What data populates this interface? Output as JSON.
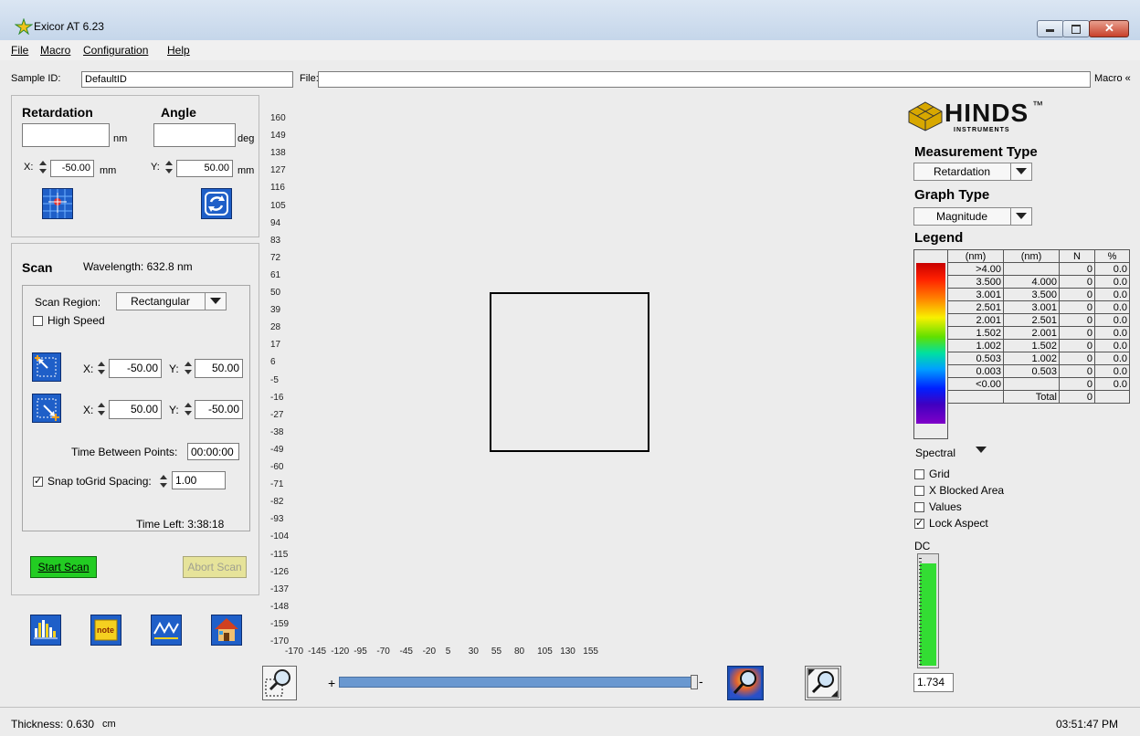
{
  "window": {
    "title": "Exicor AT 6.23"
  },
  "menu": [
    "File",
    "Macro",
    "Configuration",
    "Help"
  ],
  "topbar": {
    "sample_id_label": "Sample ID:",
    "sample_id_value": "DefaultID",
    "file_label": "File:",
    "file_value": "",
    "macro_label": "Macro «"
  },
  "measure": {
    "retardation_label": "Retardation",
    "angle_label": "Angle",
    "retardation_value": "",
    "retardation_unit": "nm",
    "angle_value": "",
    "angle_unit": "deg",
    "x_label": "X:",
    "x_value": "-50.00",
    "x_unit": "mm",
    "y_label": "Y:",
    "y_value": "50.00",
    "y_unit": "mm"
  },
  "scan": {
    "title": "Scan",
    "wavelength": "Wavelength: 632.8 nm",
    "region_label": "Scan Region:",
    "region_value": "Rectangular",
    "high_speed_label": "High Speed",
    "p1_x_label": "X:",
    "p1_x": "-50.00",
    "p1_y_label": "Y:",
    "p1_y": "50.00",
    "p2_x_label": "X:",
    "p2_x": "50.00",
    "p2_y_label": "Y:",
    "p2_y": "-50.00",
    "time_between_label": "Time Between Points:",
    "time_between_value": "00:00:00",
    "snap_label": "Snap to",
    "grid_spacing_label": "Grid Spacing:",
    "grid_spacing_value": "1.00",
    "time_left": "Time Left:  3:38:18",
    "start_label": "Start Scan",
    "abort_label": "Abort Scan"
  },
  "graph": {
    "y_ticks": [
      "160",
      "149",
      "138",
      "127",
      "116",
      "105",
      "94",
      "83",
      "72",
      "61",
      "50",
      "39",
      "28",
      "17",
      "6",
      "-5",
      "-16",
      "-27",
      "-38",
      "-49",
      "-60",
      "-71",
      "-82",
      "-93",
      "-104",
      "-115",
      "-126",
      "-137",
      "-148",
      "-159",
      "-170"
    ],
    "x_ticks": [
      "-170",
      "-145",
      "-120",
      "-95",
      "-70",
      "-45",
      "-20",
      "5",
      "30",
      "55",
      "80",
      "105",
      "130",
      "155"
    ],
    "zoom_plus": "+",
    "zoom_minus": "-"
  },
  "right": {
    "logo_text": "HINDS",
    "logo_tm": "™",
    "logo_sub": "INSTRUMENTS",
    "measurement_type_label": "Measurement Type",
    "measurement_type_value": "Retardation",
    "graph_type_label": "Graph Type",
    "graph_type_value": "Magnitude",
    "legend_label": "Legend",
    "legend_headers": [
      "(nm)",
      "(nm)",
      "N",
      "%"
    ],
    "legend_rows": [
      [
        ">4.00",
        "",
        "0",
        "0.0"
      ],
      [
        "3.500",
        "4.000",
        "0",
        "0.0"
      ],
      [
        "3.001",
        "3.500",
        "0",
        "0.0"
      ],
      [
        "2.501",
        "3.001",
        "0",
        "0.0"
      ],
      [
        "2.001",
        "2.501",
        "0",
        "0.0"
      ],
      [
        "1.502",
        "2.001",
        "0",
        "0.0"
      ],
      [
        "1.002",
        "1.502",
        "0",
        "0.0"
      ],
      [
        "0.503",
        "1.002",
        "0",
        "0.0"
      ],
      [
        "0.003",
        "0.503",
        "0",
        "0.0"
      ],
      [
        "<0.00",
        "",
        "0",
        "0.0"
      ],
      [
        "",
        "Total",
        "0",
        ""
      ]
    ],
    "spectral_label": "Spectral",
    "checks": [
      {
        "label": "Grid",
        "checked": false
      },
      {
        "label": "X Blocked Area",
        "checked": false
      },
      {
        "label": "Values",
        "checked": false
      },
      {
        "label": "Lock Aspect",
        "checked": true
      }
    ],
    "dc_label": "DC",
    "dc_value": "1.734",
    "dc_level": 0.93
  },
  "status": {
    "thickness_label": "Thickness:",
    "thickness_value": "0.630",
    "thickness_unit": "cm",
    "clock": "03:51:47 PM"
  },
  "colors": {
    "start_button": "#22cc22",
    "abort_button": "#e6e39a",
    "dc_fill": "#33dd33",
    "zoom_bar": "#6a98d0"
  },
  "icons": [
    "app-icon",
    "minimize-icon",
    "maximize-icon",
    "close-icon",
    "map-target-icon",
    "refresh-icon",
    "top-left-corner-icon",
    "bottom-right-corner-icon",
    "histogram-icon",
    "note-icon",
    "profile-icon",
    "home-icon",
    "zoom-region-icon",
    "zoom-color-icon",
    "zoom-fit-icon",
    "dropdown-arrow-icon"
  ]
}
